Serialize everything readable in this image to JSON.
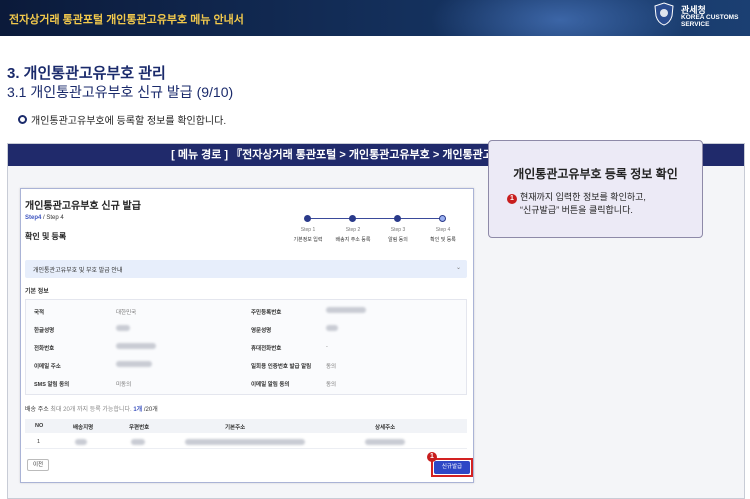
{
  "header": {
    "title": "전자상거래 통관포털 개인통관고유부호 메뉴 안내서",
    "agency_kr": "관세청",
    "agency_en": "KOREA CUSTOMS SERVICE"
  },
  "section": {
    "h1": "3. 개인통관고유부호 관리",
    "h2": "3.1 개인통관고유부호 신규 발급 (9/10)",
    "bullet": "개인통관고유부호에 등록할 정보를 확인합니다."
  },
  "route": "[ 메뉴 경로 ] 『전자상거래 통관포털 > 개인통관고유부호 > 개인통관고유부호 신규 발급』",
  "screenshot": {
    "page_title": "개인통관고유부호 신규 발급",
    "step_current": "Step4",
    "step_total": " / Step 4",
    "confirm_title": "확인 및 등록",
    "steps": [
      {
        "step": "Step 1",
        "label": "기본정보 입력"
      },
      {
        "step": "Step 2",
        "label": "배송지 주소 등록"
      },
      {
        "step": "Step 3",
        "label": "알림 동의"
      },
      {
        "step": "Step 4",
        "label": "확인 및 등록"
      }
    ],
    "accordion_label": "개인통관고유부호 및 부호 발급 안내",
    "basic_info": "기본 정보",
    "fields": {
      "nationality_label": "국적",
      "nationality_value": "대한민국",
      "rrn_label": "주민등록번호",
      "kname_label": "한글성명",
      "ename_label": "영문성명",
      "phone_label": "전화번호",
      "mobile_label": "휴대전화번호",
      "mobile_value": "-",
      "email_label": "이메일 주소",
      "consent_label": "일회용 인증번호 발급 알림",
      "consent_value": "동의",
      "sms_label": "SMS 알림 동의",
      "sms_value": "미동의",
      "email_alert_label": "이메일 알림 동의",
      "email_alert_value": "동의"
    },
    "shipping": {
      "label": "배송 주소",
      "note": "최대 20개 까지 등록 가능합니다.",
      "count_prefix": "1개",
      "count_suffix": " /20개"
    },
    "table_headers": [
      "NO",
      "배송지명",
      "우편번호",
      "기본주소",
      "상세주소"
    ],
    "table_row_no": "1",
    "prev_button": "이전",
    "issue_button": "신규발급",
    "marker": "1"
  },
  "callout": {
    "title": "개인통관고유부호 등록 정보 확인",
    "marker": "1",
    "line1": "현재까지 입력한 정보를 확인하고,",
    "line2": "“신규발급” 버튼을 클릭합니다."
  }
}
